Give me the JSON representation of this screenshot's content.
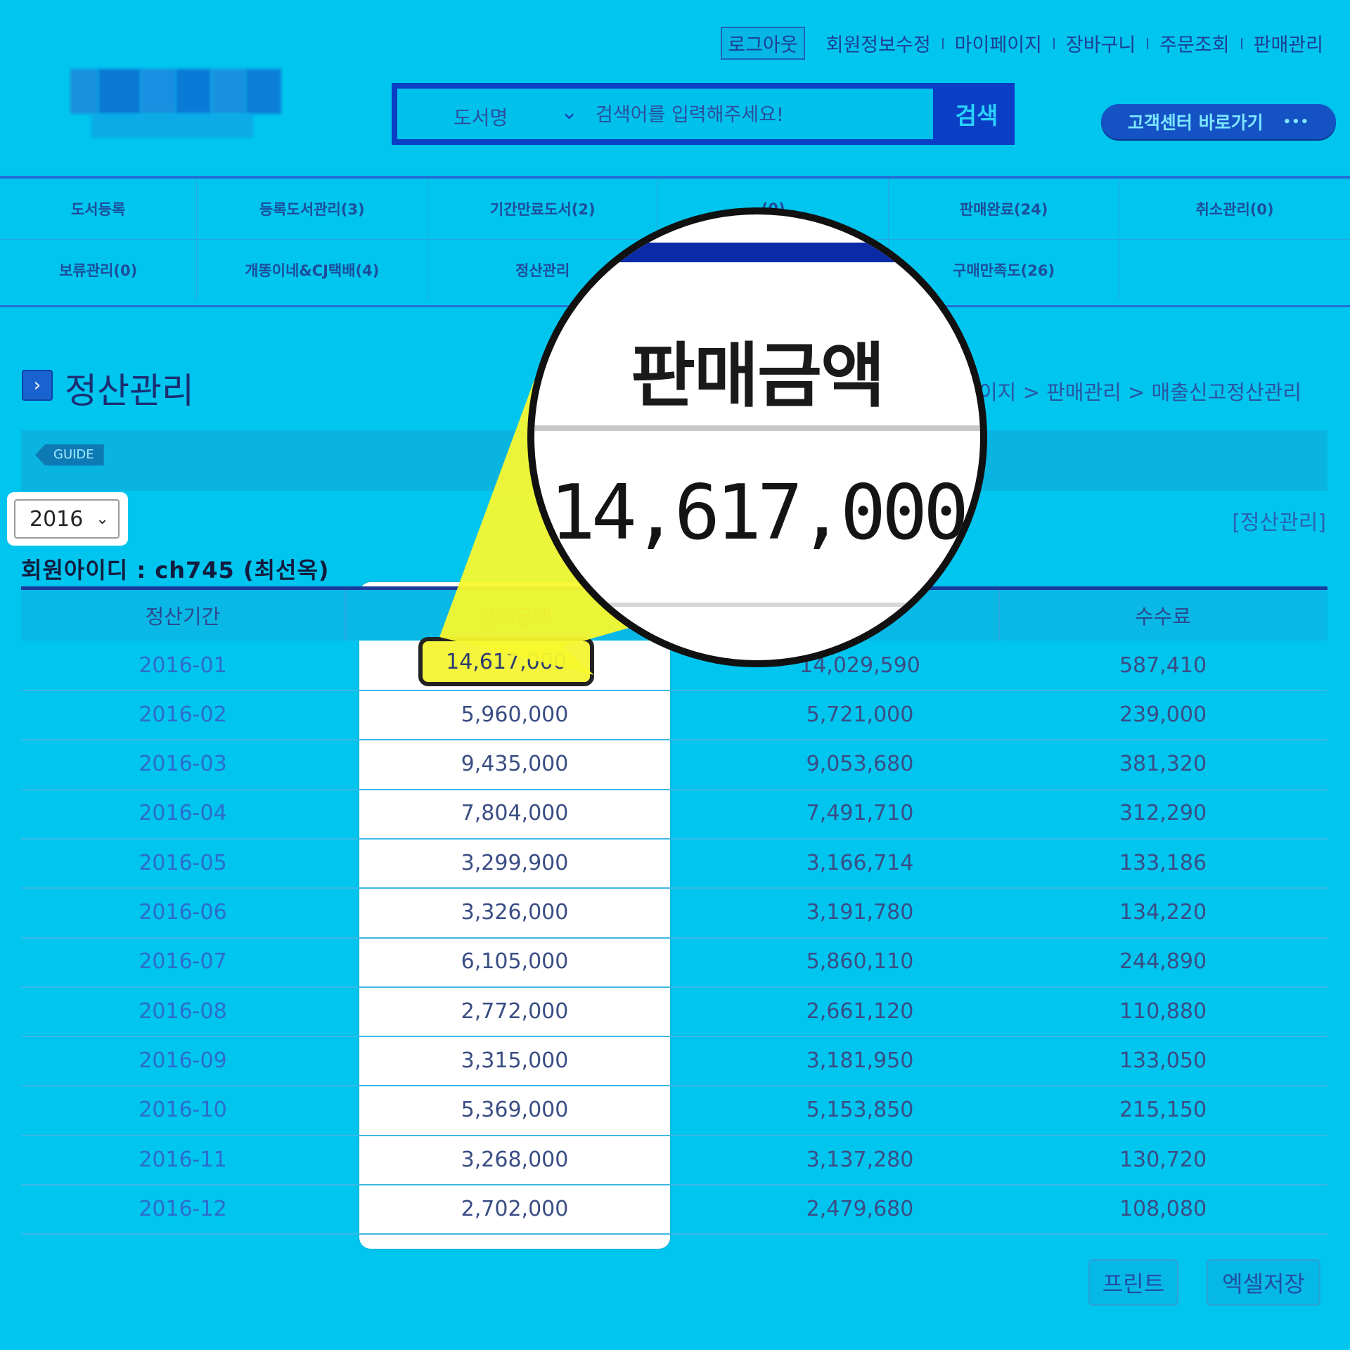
{
  "top_links": [
    "로그아웃",
    "회원정보수정",
    "마이페이지",
    "장바구니",
    "주문조회",
    "판매관리"
  ],
  "search": {
    "category": "도서명",
    "placeholder": "검색어를 입력해주세요!",
    "button": "검색"
  },
  "cs_button": {
    "label": "고객센터 바로가기",
    "dots": "•••"
  },
  "nav": {
    "row1": [
      "도서등록",
      "등록도서관리(3)",
      "기간만료도서(2)",
      "(0)",
      "판매완료(24)",
      "취소관리(0)"
    ],
    "row2": [
      "보류관리(0)",
      "개똥이네&CJ택배(4)",
      "정산관리",
      "",
      "구매만족도(26)",
      ""
    ]
  },
  "page": {
    "title": "정산관리",
    "breadcrumb": "이지 > 판매관리 > 매출신고정산관리",
    "guide": "GUIDE",
    "year": "2016",
    "settle_link": "[정산관리]",
    "member_info": "회원아이디 : ch745 (최선옥)"
  },
  "table": {
    "headers": [
      "정산기간",
      "판매금액",
      "",
      "수수료"
    ],
    "rows": [
      {
        "period": "2016-01",
        "sales": "14,617,000",
        "settle": "14,029,590",
        "fee": "587,410"
      },
      {
        "period": "2016-02",
        "sales": "5,960,000",
        "settle": "5,721,000",
        "fee": "239,000"
      },
      {
        "period": "2016-03",
        "sales": "9,435,000",
        "settle": "9,053,680",
        "fee": "381,320"
      },
      {
        "period": "2016-04",
        "sales": "7,804,000",
        "settle": "7,491,710",
        "fee": "312,290"
      },
      {
        "period": "2016-05",
        "sales": "3,299,900",
        "settle": "3,166,714",
        "fee": "133,186"
      },
      {
        "period": "2016-06",
        "sales": "3,326,000",
        "settle": "3,191,780",
        "fee": "134,220"
      },
      {
        "period": "2016-07",
        "sales": "6,105,000",
        "settle": "5,860,110",
        "fee": "244,890"
      },
      {
        "period": "2016-08",
        "sales": "2,772,000",
        "settle": "2,661,120",
        "fee": "110,880"
      },
      {
        "period": "2016-09",
        "sales": "3,315,000",
        "settle": "3,181,950",
        "fee": "133,050"
      },
      {
        "period": "2016-10",
        "sales": "5,369,000",
        "settle": "5,153,850",
        "fee": "215,150"
      },
      {
        "period": "2016-11",
        "sales": "3,268,000",
        "settle": "3,137,280",
        "fee": "130,720"
      },
      {
        "period": "2016-12",
        "sales": "2,702,000",
        "settle": "2,479,680",
        "fee": "108,080"
      }
    ]
  },
  "magnifier": {
    "label": "판매금액",
    "value": "14,617,000"
  },
  "buttons": {
    "print": "프린트",
    "excel": "엑셀저장"
  },
  "colors": {
    "background": "#00c5ef",
    "highlight": "#f5f53d",
    "nav_border": "#2270d6"
  }
}
